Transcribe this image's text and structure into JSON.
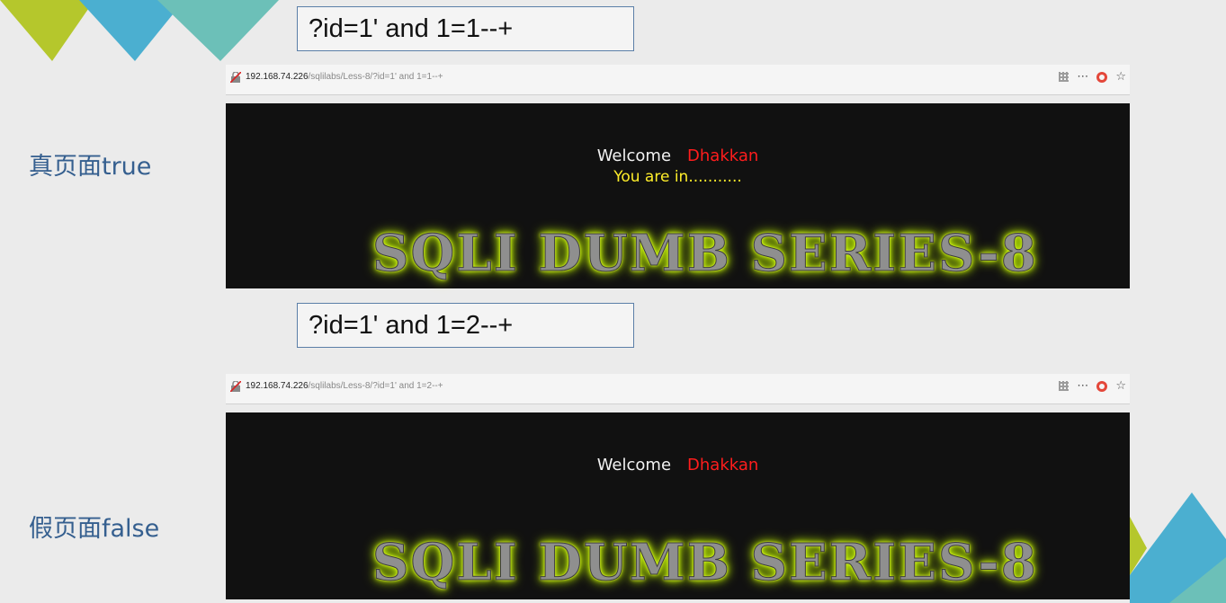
{
  "slide": {
    "colors": {
      "accent_green": "#b5c72c",
      "accent_blue": "#4bafd0",
      "accent_teal": "#6cc0b8",
      "label_blue": "#355f8f"
    }
  },
  "sections": {
    "true_case": {
      "query": "?id=1' and 1=1--+",
      "label": "真页面true",
      "url_host": "192.168.74.226",
      "url_path": "/sqlilabs/Less-8/?id=1' and 1=1--+",
      "welcome": "Welcome",
      "user": "Dhakkan",
      "message": "You are in...........",
      "banner": "SQLI DUMB SERIES-8"
    },
    "false_case": {
      "query": "?id=1' and 1=2--+",
      "label": "假页面false",
      "url_host": "192.168.74.226",
      "url_path": "/sqlilabs/Less-8/?id=1' and 1=2--+",
      "welcome": "Welcome",
      "user": "Dhakkan",
      "banner": "SQLI DUMB SERIES-8"
    }
  },
  "browser_icons": [
    "qr-code-icon",
    "more-icon",
    "pocket-icon",
    "bookmark-star-icon"
  ]
}
